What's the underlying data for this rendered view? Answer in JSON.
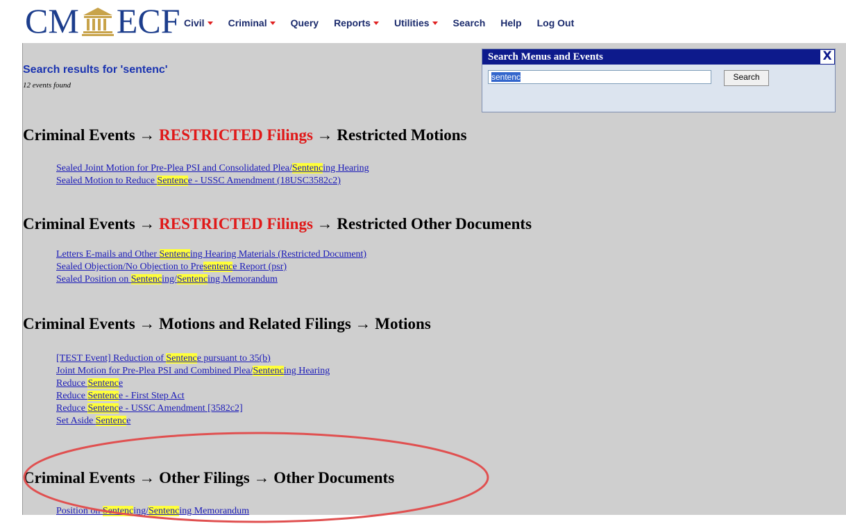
{
  "logo": {
    "left": "CM",
    "right": "ECF"
  },
  "menu": [
    {
      "label": "Civil",
      "dropdown": true
    },
    {
      "label": "Criminal",
      "dropdown": true
    },
    {
      "label": "Query",
      "dropdown": false
    },
    {
      "label": "Reports",
      "dropdown": true
    },
    {
      "label": "Utilities",
      "dropdown": true
    },
    {
      "label": "Search",
      "dropdown": false
    },
    {
      "label": "Help",
      "dropdown": false
    },
    {
      "label": "Log Out",
      "dropdown": false
    }
  ],
  "results": {
    "title": "Search results for 'sentenc'",
    "count": "12 events found"
  },
  "search_panel": {
    "title": "Search Menus and Events",
    "close": "X",
    "value": "sentenc",
    "button": "Search"
  },
  "sections": [
    {
      "head": {
        "a": "Criminal Events → ",
        "red": "RESTRICTED Filings",
        "b": " → Restricted Motions"
      },
      "links": [
        [
          {
            "t": "Sealed Joint Motion for Pre-Plea PSI and Consolidated Plea/"
          },
          {
            "t": "Sentenc",
            "h": true
          },
          {
            "t": "ing Hearing"
          }
        ],
        [
          {
            "t": "Sealed Motion to Reduce "
          },
          {
            "t": "Sentenc",
            "h": true
          },
          {
            "t": "e - USSC Amendment (18USC3582c2)"
          }
        ]
      ]
    },
    {
      "head": {
        "a": "Criminal Events → ",
        "red": "RESTRICTED Filings",
        "b": " → Restricted Other Documents"
      },
      "links": [
        [
          {
            "t": "Letters E-mails and Other "
          },
          {
            "t": "Sentenc",
            "h": true
          },
          {
            "t": "ing Hearing Materials (Restricted Document)"
          }
        ],
        [
          {
            "t": "Sealed Objection/No Objection to Pre"
          },
          {
            "t": "sentenc",
            "h": true
          },
          {
            "t": "e Report (psr)"
          }
        ],
        [
          {
            "t": "Sealed Position on "
          },
          {
            "t": "Sentenc",
            "h": true
          },
          {
            "t": "ing/"
          },
          {
            "t": "Sentenc",
            "h": true
          },
          {
            "t": "ing Memorandum"
          }
        ]
      ]
    },
    {
      "head": {
        "a": "Criminal Events → Motions and Related Filings → Motions",
        "red": "",
        "b": ""
      },
      "links": [
        [
          {
            "t": "[TEST Event] Reduction of "
          },
          {
            "t": "Sentenc",
            "h": true
          },
          {
            "t": "e pursuant to 35(b)"
          }
        ],
        [
          {
            "t": "Joint Motion for Pre-Plea PSI and Combined Plea/"
          },
          {
            "t": "Sentenc",
            "h": true
          },
          {
            "t": "ing Hearing"
          }
        ],
        [
          {
            "t": "Reduce "
          },
          {
            "t": "Sentenc",
            "h": true
          },
          {
            "t": "e"
          }
        ],
        [
          {
            "t": "Reduce "
          },
          {
            "t": "Sentenc",
            "h": true
          },
          {
            "t": "e - First Step Act"
          }
        ],
        [
          {
            "t": "Reduce "
          },
          {
            "t": "Sentenc",
            "h": true
          },
          {
            "t": "e - USSC Amendment [3582c2]"
          }
        ],
        [
          {
            "t": "Set Aside "
          },
          {
            "t": "Sentenc",
            "h": true
          },
          {
            "t": "e"
          }
        ]
      ]
    },
    {
      "head": {
        "a": "Criminal Events → Other Filings → Other Documents",
        "red": "",
        "b": ""
      },
      "links": [
        [
          {
            "t": "Position on "
          },
          {
            "t": "Sentenc",
            "h": true
          },
          {
            "t": "ing/"
          },
          {
            "t": "Sentenc",
            "h": true
          },
          {
            "t": "ing Memorandum"
          }
        ]
      ]
    }
  ],
  "colors": {
    "highlight": "#ffff3a",
    "header_blue": "#0d1a8c",
    "annotation": "#e05050",
    "link": "#1a1ab8"
  }
}
